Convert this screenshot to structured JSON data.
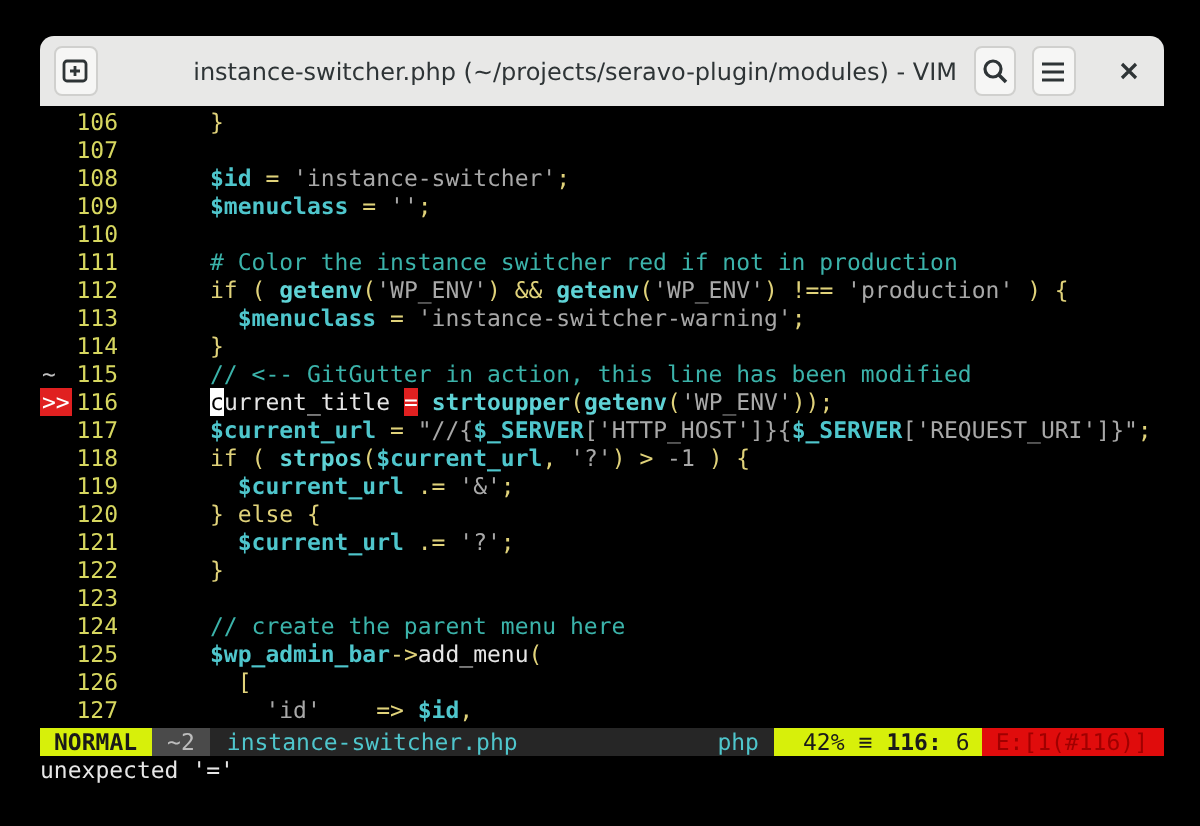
{
  "window": {
    "title": "instance-switcher.php (~/projects/seravo-plugin/modules) - VIM"
  },
  "editor": {
    "lines": [
      {
        "number": "106",
        "tokens": [
          {
            "kind": "punct",
            "text": "}"
          }
        ]
      },
      {
        "number": "107"
      },
      {
        "number": "108",
        "tokens": [
          {
            "kind": "var",
            "text": "$id"
          },
          {
            "kind": "punct",
            "text": " = "
          },
          {
            "kind": "string",
            "text": "'instance-switcher'"
          },
          {
            "kind": "punct",
            "text": ";"
          }
        ]
      },
      {
        "number": "109",
        "tokens": [
          {
            "kind": "var",
            "text": "$menuclass"
          },
          {
            "kind": "punct",
            "text": " = "
          },
          {
            "kind": "string",
            "text": "''"
          },
          {
            "kind": "punct",
            "text": ";"
          }
        ]
      },
      {
        "number": "110"
      },
      {
        "number": "111",
        "tokens": [
          {
            "kind": "comment",
            "text": "# Color the instance switcher red if not in production"
          }
        ]
      },
      {
        "number": "112",
        "tokens": [
          {
            "kind": "punct",
            "text": "if ( "
          },
          {
            "kind": "func",
            "text": "getenv"
          },
          {
            "kind": "punct",
            "text": "("
          },
          {
            "kind": "string",
            "text": "'WP_ENV'"
          },
          {
            "kind": "punct",
            "text": ") && "
          },
          {
            "kind": "func",
            "text": "getenv"
          },
          {
            "kind": "punct",
            "text": "("
          },
          {
            "kind": "string",
            "text": "'WP_ENV'"
          },
          {
            "kind": "punct",
            "text": ") !== "
          },
          {
            "kind": "string",
            "text": "'production'"
          },
          {
            "kind": "punct",
            "text": " ) {"
          }
        ]
      },
      {
        "number": "113",
        "tokens": [
          {
            "kind": "var",
            "text": "  $menuclass"
          },
          {
            "kind": "punct",
            "text": " = "
          },
          {
            "kind": "string",
            "text": "'instance-switcher-warning'"
          },
          {
            "kind": "punct",
            "text": ";"
          }
        ]
      },
      {
        "number": "114",
        "tokens": [
          {
            "kind": "punct",
            "text": "}"
          }
        ]
      },
      {
        "number": "115",
        "sign": {
          "text": "~",
          "kind": "change"
        },
        "tokens": [
          {
            "kind": "comment",
            "text": "// <-- GitGutter in action, this line has been modified"
          }
        ]
      },
      {
        "number": "116",
        "sign": {
          "text": ">>",
          "kind": "error"
        },
        "tokens": [
          {
            "kind": "cursor",
            "text": "c"
          },
          {
            "kind": "plain",
            "text": "urrent_title "
          },
          {
            "kind": "error",
            "text": "="
          },
          {
            "kind": "func",
            "text": " strtoupper"
          },
          {
            "kind": "punct",
            "text": "("
          },
          {
            "kind": "func",
            "text": "getenv"
          },
          {
            "kind": "punct",
            "text": "("
          },
          {
            "kind": "string",
            "text": "'WP_ENV'"
          },
          {
            "kind": "punct",
            "text": "));"
          }
        ]
      },
      {
        "number": "117",
        "tokens": [
          {
            "kind": "var",
            "text": "$current_url"
          },
          {
            "kind": "punct",
            "text": " = "
          },
          {
            "kind": "string",
            "text": "\"//{"
          },
          {
            "kind": "var",
            "text": "$_SERVER"
          },
          {
            "kind": "string",
            "text": "['HTTP_HOST']}{"
          },
          {
            "kind": "var",
            "text": "$_SERVER"
          },
          {
            "kind": "string",
            "text": "['REQUEST_URI']}\""
          },
          {
            "kind": "punct",
            "text": ";"
          }
        ]
      },
      {
        "number": "118",
        "tokens": [
          {
            "kind": "punct",
            "text": "if ( "
          },
          {
            "kind": "func",
            "text": "strpos"
          },
          {
            "kind": "punct",
            "text": "("
          },
          {
            "kind": "var",
            "text": "$current_url"
          },
          {
            "kind": "punct",
            "text": ", "
          },
          {
            "kind": "string",
            "text": "'?'"
          },
          {
            "kind": "punct",
            "text": ") > "
          },
          {
            "kind": "string",
            "text": "-1"
          },
          {
            "kind": "punct",
            "text": " ) {"
          }
        ]
      },
      {
        "number": "119",
        "tokens": [
          {
            "kind": "var",
            "text": "  $current_url"
          },
          {
            "kind": "punct",
            "text": " .= "
          },
          {
            "kind": "string",
            "text": "'&'"
          },
          {
            "kind": "punct",
            "text": ";"
          }
        ]
      },
      {
        "number": "120",
        "tokens": [
          {
            "kind": "punct",
            "text": "} else {"
          }
        ]
      },
      {
        "number": "121",
        "tokens": [
          {
            "kind": "var",
            "text": "  $current_url"
          },
          {
            "kind": "punct",
            "text": " .= "
          },
          {
            "kind": "string",
            "text": "'?'"
          },
          {
            "kind": "punct",
            "text": ";"
          }
        ]
      },
      {
        "number": "122",
        "tokens": [
          {
            "kind": "punct",
            "text": "}"
          }
        ]
      },
      {
        "number": "123"
      },
      {
        "number": "124",
        "tokens": [
          {
            "kind": "comment",
            "text": "// create the parent menu here"
          }
        ]
      },
      {
        "number": "125",
        "tokens": [
          {
            "kind": "var",
            "text": "$wp_admin_bar"
          },
          {
            "kind": "punct",
            "text": "->"
          },
          {
            "kind": "plain",
            "text": "add_menu"
          },
          {
            "kind": "punct",
            "text": "("
          }
        ]
      },
      {
        "number": "126",
        "tokens": [
          {
            "kind": "punct",
            "text": "  ["
          }
        ]
      },
      {
        "number": "127",
        "tokens": [
          {
            "kind": "string",
            "text": "    'id'"
          },
          {
            "kind": "punct",
            "text": "    => "
          },
          {
            "kind": "var",
            "text": "$id"
          },
          {
            "kind": "punct",
            "text": ","
          }
        ]
      }
    ]
  },
  "statusline": {
    "mode": "NORMAL",
    "hunks": "~2",
    "filename": "instance-switcher.php",
    "filetype": "php",
    "percent": "42%",
    "line_symbol": "≡",
    "line": "116:",
    "column": "6",
    "errors": "E:[1(#116)]"
  },
  "command_line": "unexpected '='"
}
